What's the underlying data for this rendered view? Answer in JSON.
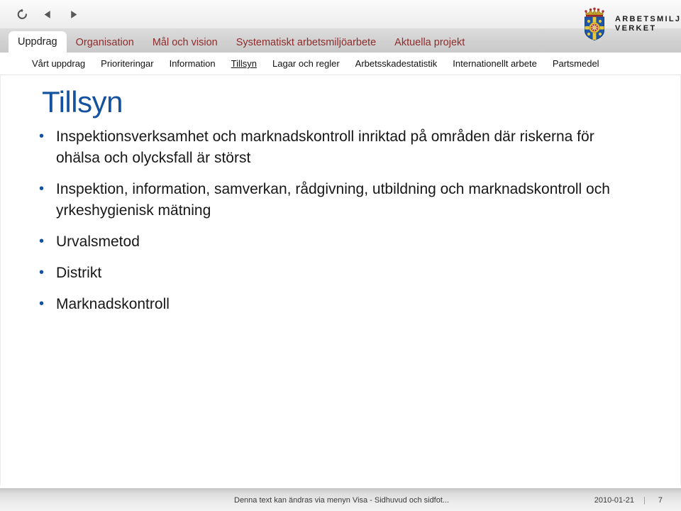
{
  "toolbar": {
    "icons": [
      {
        "name": "refresh-icon",
        "glyph": "refresh"
      },
      {
        "name": "previous-icon",
        "glyph": "left-triangle"
      },
      {
        "name": "next-icon",
        "glyph": "right-triangle"
      }
    ]
  },
  "tabs": {
    "active": "Uppdrag",
    "items": [
      "Uppdrag",
      "Organisation",
      "Mål och vision",
      "Systematiskt arbetsmiljöarbete",
      "Aktuella projekt"
    ]
  },
  "subnav": {
    "active": "Tillsyn",
    "items": [
      "Vårt uppdrag",
      "Prioriteringar",
      "Information",
      "Tillsyn",
      "Lagar och regler",
      "Arbetsskadestatistik",
      "Internationellt arbete",
      "Partsmedel"
    ]
  },
  "logo": {
    "line1": "ARBETSMILJÖ",
    "line2": "VERKET",
    "crest_name": "swedish-coat-of-arms"
  },
  "slide": {
    "title": "Tillsyn",
    "bullets": [
      "Inspektionsverksamhet och marknadskontroll inriktad på områden där riskerna för ohälsa och olycksfall är störst",
      "Inspektion, information, samverkan, rådgivning, utbildning och marknadskontroll och yrkeshygienisk mätning",
      "Urvalsmetod",
      "Distrikt",
      "Marknadskontroll"
    ]
  },
  "footer": {
    "note": "Denna text kan ändras via menyn Visa - Sidhuvud och sidfot...",
    "date": "2010-01-21",
    "separator": "|",
    "page": "7"
  },
  "colors": {
    "title_blue": "#14529f",
    "tab_red": "#8f2b2b",
    "bullet_blue": "#14529f"
  }
}
